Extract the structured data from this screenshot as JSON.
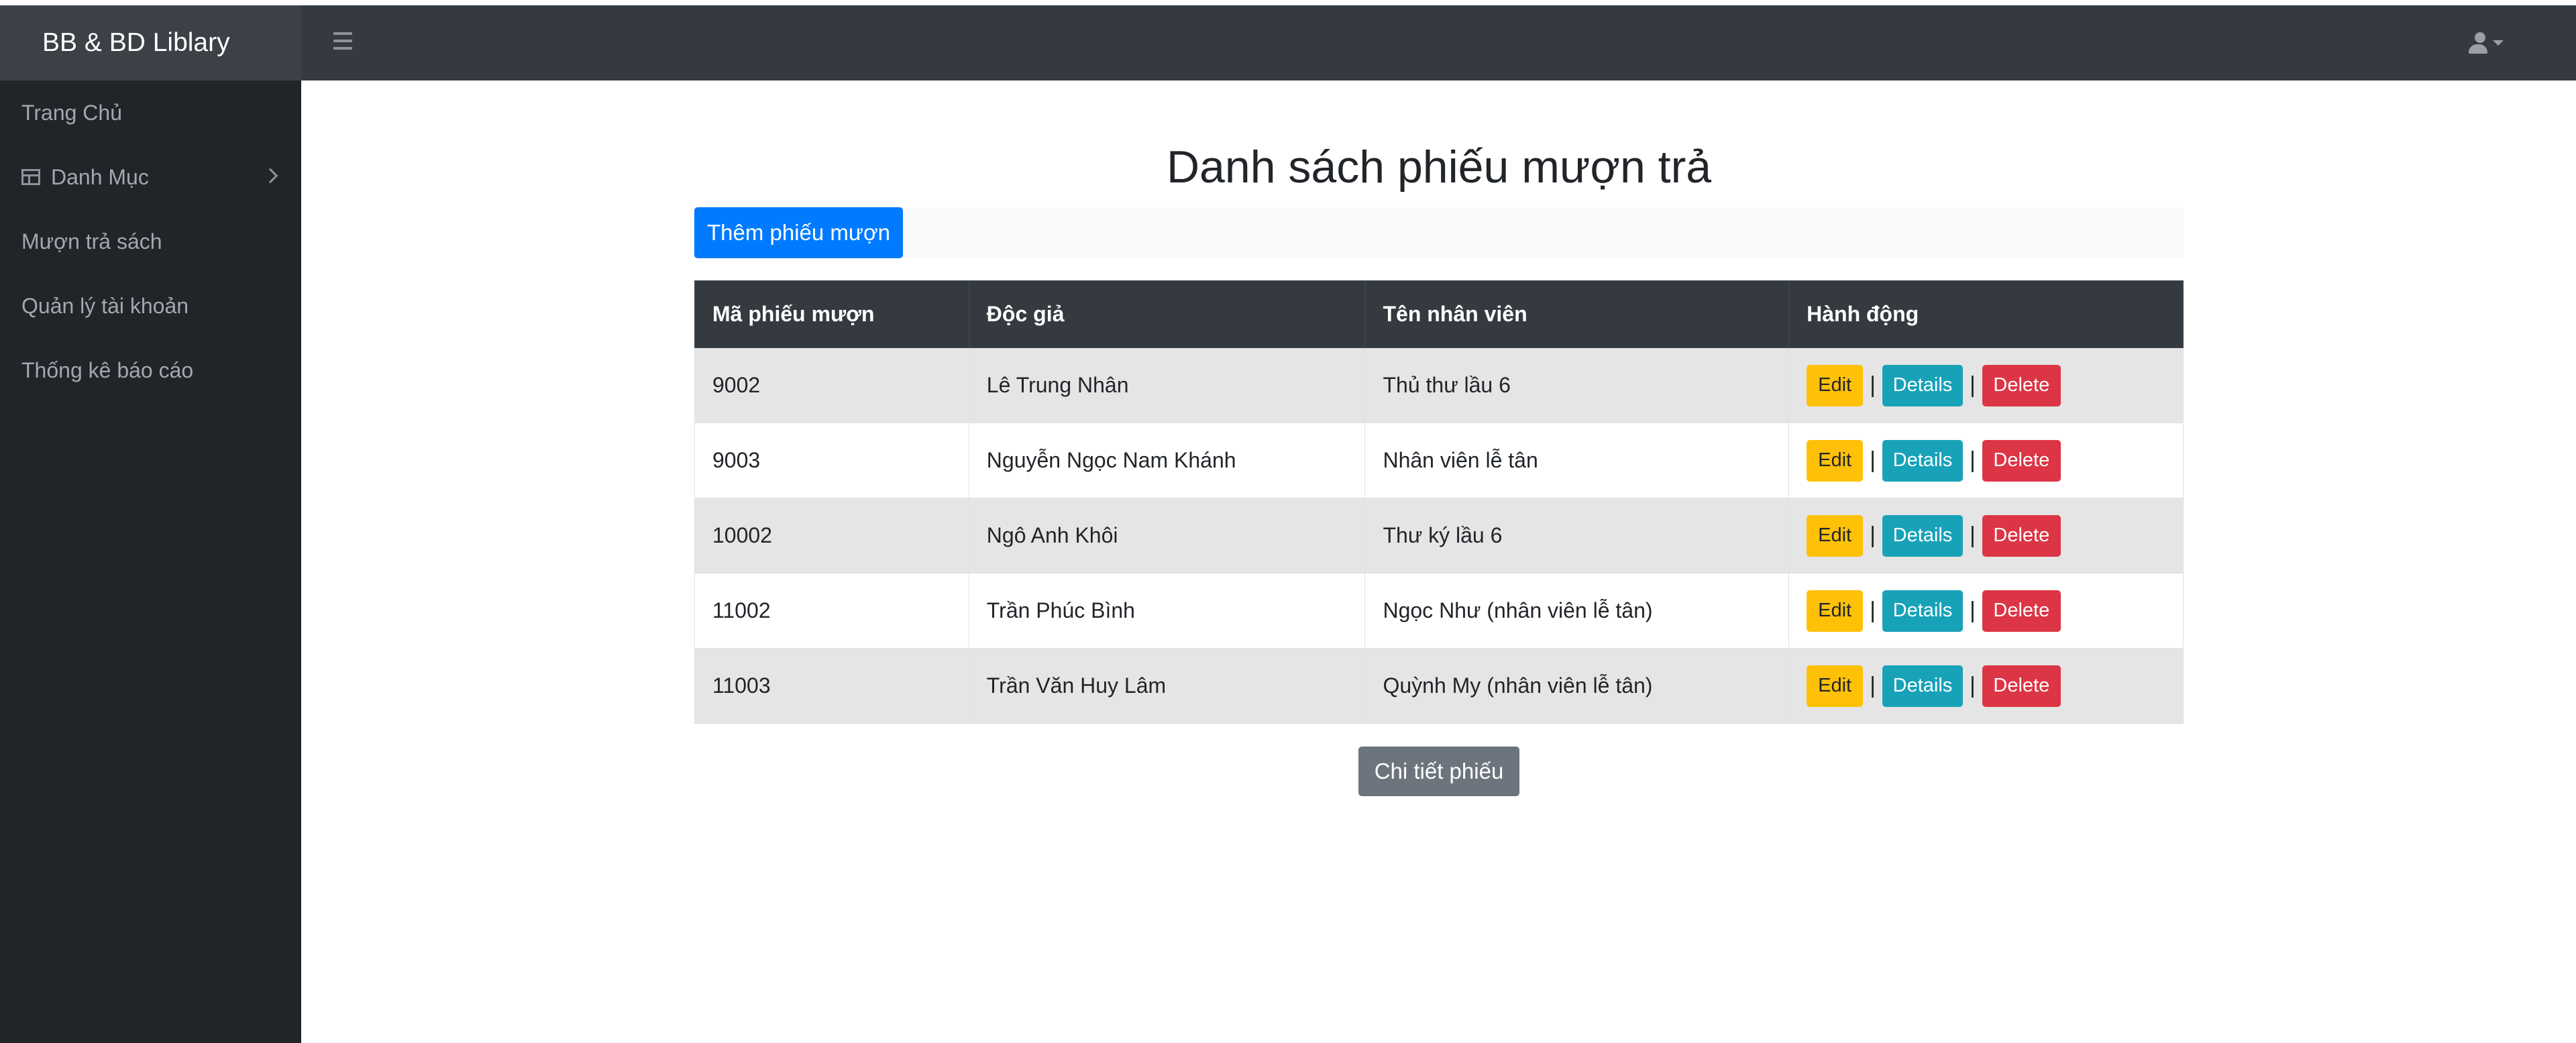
{
  "app": {
    "brand": "BB & BD Liblary"
  },
  "sidebar": {
    "items": [
      {
        "label": "Trang Chủ"
      },
      {
        "label": "Danh Mục",
        "icon": "table-icon",
        "has_submenu": true
      },
      {
        "label": "Mượn trả sách"
      },
      {
        "label": "Quản lý tài khoản"
      },
      {
        "label": "Thống kê báo cáo"
      }
    ]
  },
  "main": {
    "title": "Danh sách phiếu mượn trả",
    "add_button": "Thêm phiếu mượn",
    "detail_button": "Chi tiết phiếu",
    "table": {
      "headers": [
        "Mã phiếu mượn",
        "Độc giả",
        "Tên nhân viên",
        "Hành động"
      ],
      "rows": [
        [
          "9002",
          "Lê Trung Nhân",
          "Thủ thư lầu 6"
        ],
        [
          "9003",
          "Nguyễn Ngọc Nam Khánh",
          "Nhân viên lễ tân"
        ],
        [
          "10002",
          "Ngô Anh Khôi",
          "Thư ký lầu 6"
        ],
        [
          "11002",
          "Trần Phúc Bình",
          "Ngọc Như (nhân viên lễ tân)"
        ],
        [
          "11003",
          "Trần Văn Huy Lâm",
          "Quỳnh My (nhân viên lễ tân)"
        ]
      ],
      "actions": {
        "edit": "Edit",
        "details": "Details",
        "delete": "Delete",
        "separator": "|"
      }
    }
  },
  "colors": {
    "topbar": "#343a40",
    "sidebar": "#212529",
    "primary": "#007bff",
    "warning": "#ffc107",
    "info": "#17a2b8",
    "danger": "#dc3545",
    "secondary": "#6c757d"
  }
}
